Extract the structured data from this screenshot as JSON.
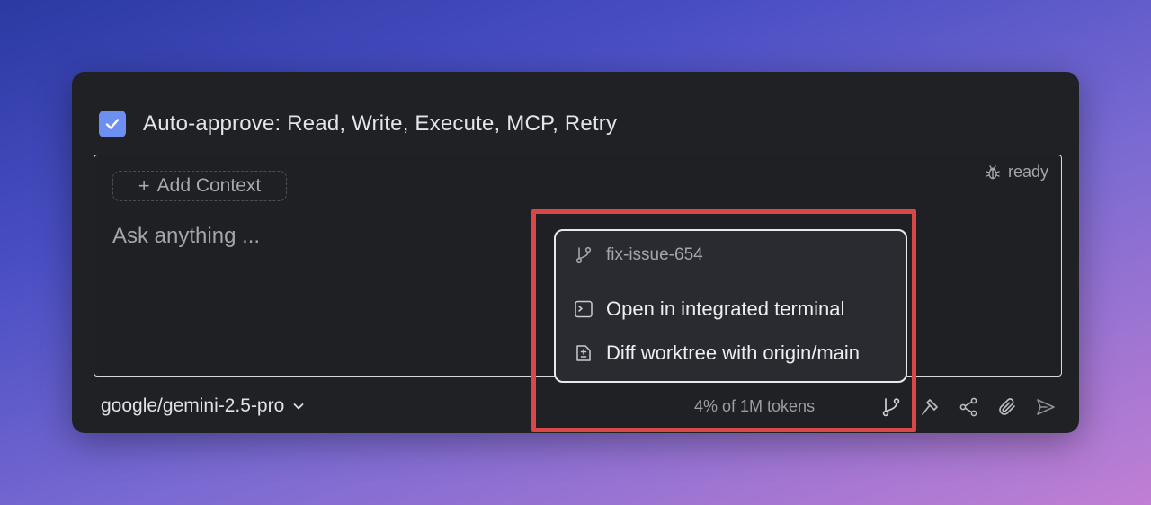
{
  "auto_approve": {
    "checked": true,
    "label": "Auto-approve: Read, Write, Execute, MCP, Retry"
  },
  "input": {
    "add_context_label": "Add Context",
    "placeholder": "Ask anything ...",
    "status_icon": "bug-icon",
    "status_text": "ready"
  },
  "popup": {
    "branch_icon": "git-branch-icon",
    "branch": "fix-issue-654",
    "items": [
      {
        "icon": "terminal-icon",
        "label": "Open in integrated terminal"
      },
      {
        "icon": "file-diff-icon",
        "label": "Diff worktree with origin/main"
      }
    ]
  },
  "footer": {
    "model": "google/gemini-2.5-pro",
    "tokens": "4% of 1M tokens",
    "icons": [
      "git-branch-icon",
      "hammer-icon",
      "share-icon",
      "paperclip-icon",
      "send-icon"
    ]
  },
  "colors": {
    "accent": "#6d8ff2",
    "highlight": "#d94747",
    "panel": "#202125"
  }
}
